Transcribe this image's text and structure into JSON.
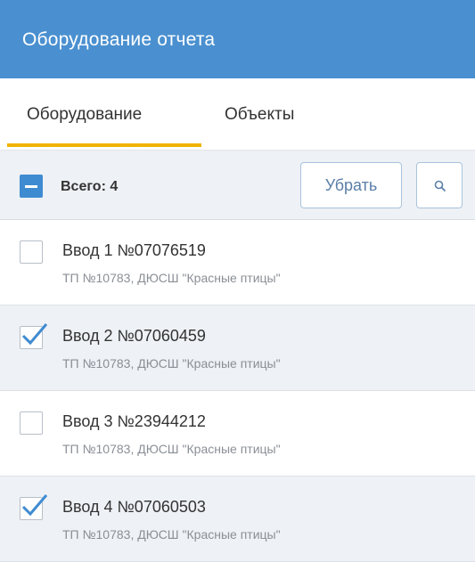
{
  "header": {
    "title": "Оборудование отчета"
  },
  "tabs": [
    {
      "label": "Оборудование",
      "active": true
    },
    {
      "label": "Объекты",
      "active": false
    }
  ],
  "toolbar": {
    "total_label": "Всего: 4",
    "remove_label": "Убрать",
    "search_icon": "search-icon"
  },
  "items": [
    {
      "title": "Ввод 1 №07076519",
      "subtitle": "ТП №10783, ДЮСШ \"Красные птицы\"",
      "checked": false
    },
    {
      "title": "Ввод 2 №07060459",
      "subtitle": "ТП №10783, ДЮСШ \"Красные птицы\"",
      "checked": true
    },
    {
      "title": "Ввод 3 №23944212",
      "subtitle": "ТП №10783, ДЮСШ \"Красные птицы\"",
      "checked": false
    },
    {
      "title": "Ввод 4 №07060503",
      "subtitle": "ТП №10783, ДЮСШ \"Красные птицы\"",
      "checked": true
    }
  ],
  "colors": {
    "header_bg": "#4a90d0",
    "tab_underline": "#f0b400",
    "accent": "#3f8bd1",
    "selected_row_bg": "#eef1f5"
  }
}
